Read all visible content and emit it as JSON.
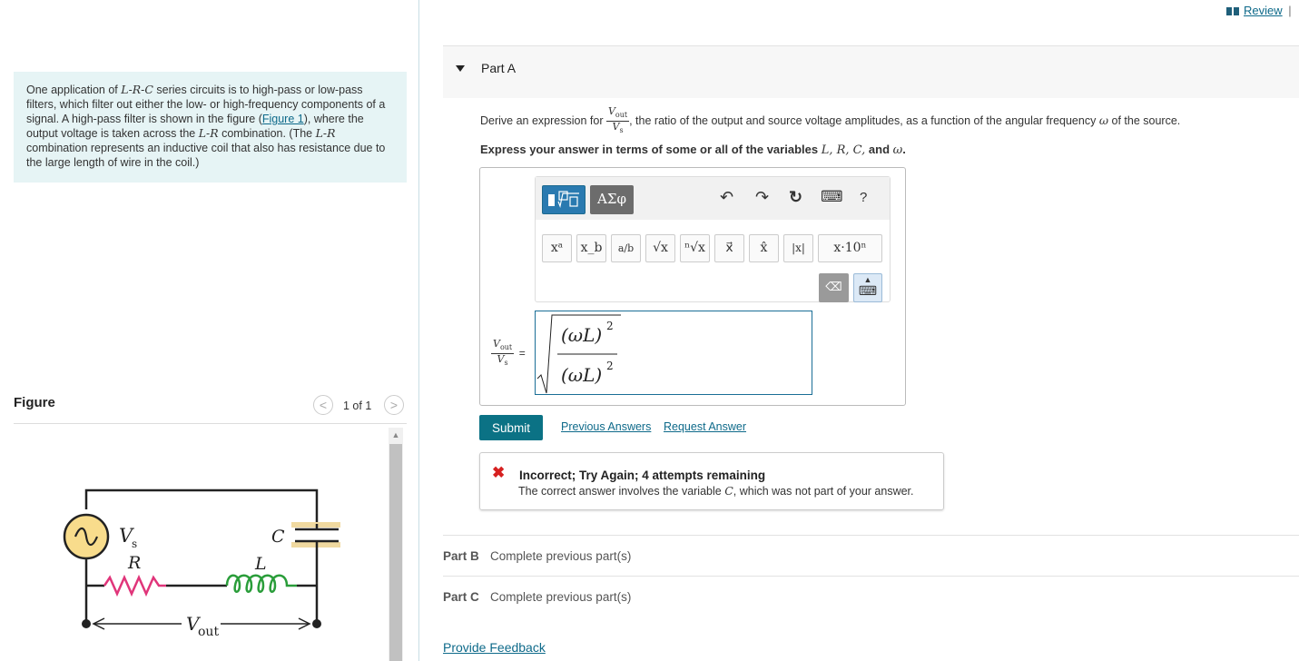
{
  "review_link": "Review",
  "review_sep": "|",
  "problem": {
    "text_parts": [
      "One application of ",
      "L",
      "-",
      "R",
      "-",
      "C",
      " series circuits is to high-pass or low-pass filters, which filter out either the low- or high-frequency components of a signal. A high-pass filter is shown in the figure (",
      "Figure 1",
      "), where the output voltage is taken across the ",
      "L",
      "-",
      "R",
      " combination. (The ",
      "L",
      "-",
      "R",
      " combination represents an inductive coil that also has resistance due to the large length of wire in the coil.)"
    ]
  },
  "figure": {
    "title": "Figure",
    "count": "1 of 1",
    "prev_glyph": "<",
    "next_glyph": ">",
    "labels": {
      "vs": "V",
      "vs_sub": "s",
      "r": "R",
      "c": "C",
      "l": "L",
      "vout": "V",
      "vout_sub": "out"
    }
  },
  "part_a": {
    "label": "Part A",
    "question_prefix": "Derive an expression for",
    "frac_num": "V",
    "frac_num_sub": "out",
    "frac_den": "V",
    "frac_den_sub": "s",
    "question_suffix": ", the ratio of the output and source voltage amplitudes, as a function of the angular frequency",
    "omega": "ω",
    "question_end": "of the source.",
    "instruction_prefix": "Express your answer in terms of some or all of the variables",
    "vars": "L, R, C,",
    "instruction_and": "and",
    "var_omega": "ω",
    "period": "."
  },
  "toolbar": {
    "greek_label": "ΑΣφ",
    "undo": "↶",
    "redo": "↷",
    "reset": "↻",
    "keyboard": "⌨",
    "help": "?",
    "buttons": [
      "xᵃ",
      "x_b",
      "a/b",
      "√x",
      "ⁿ√x",
      "x⃗",
      "x̂",
      "|x|",
      "x·10ⁿ"
    ],
    "delete": "⌫",
    "kb_toggle": "▲"
  },
  "answer": {
    "lhs_num": "V",
    "lhs_num_sub": "out",
    "lhs_den": "V",
    "lhs_den_sub": "s",
    "equals": "=",
    "num_expr": "(ωL)",
    "num_exp": "2",
    "den_expr": "(ωL)",
    "den_exp": "2"
  },
  "actions": {
    "submit": "Submit",
    "previous_answers": "Previous Answers",
    "request_answer": "Request Answer"
  },
  "feedback": {
    "icon": "✖",
    "title": "Incorrect; Try Again; 4 attempts remaining",
    "msg_prefix": "The correct answer involves the variable",
    "msg_var": "C",
    "msg_suffix": ", which was not part of your answer."
  },
  "parts": [
    {
      "label": "Part B",
      "status": "Complete previous part(s)"
    },
    {
      "label": "Part C",
      "status": "Complete previous part(s)"
    }
  ],
  "provide_feedback": "Provide Feedback",
  "colors": {
    "accent": "#0b7285",
    "link": "#0e6a8a",
    "problem_bg": "#e6f4f5",
    "error": "#d62020",
    "resistor": "#e0357a",
    "inductor": "#2a9d3a",
    "capacitor": "#f0d9a0",
    "source": "#f8dc8c"
  }
}
